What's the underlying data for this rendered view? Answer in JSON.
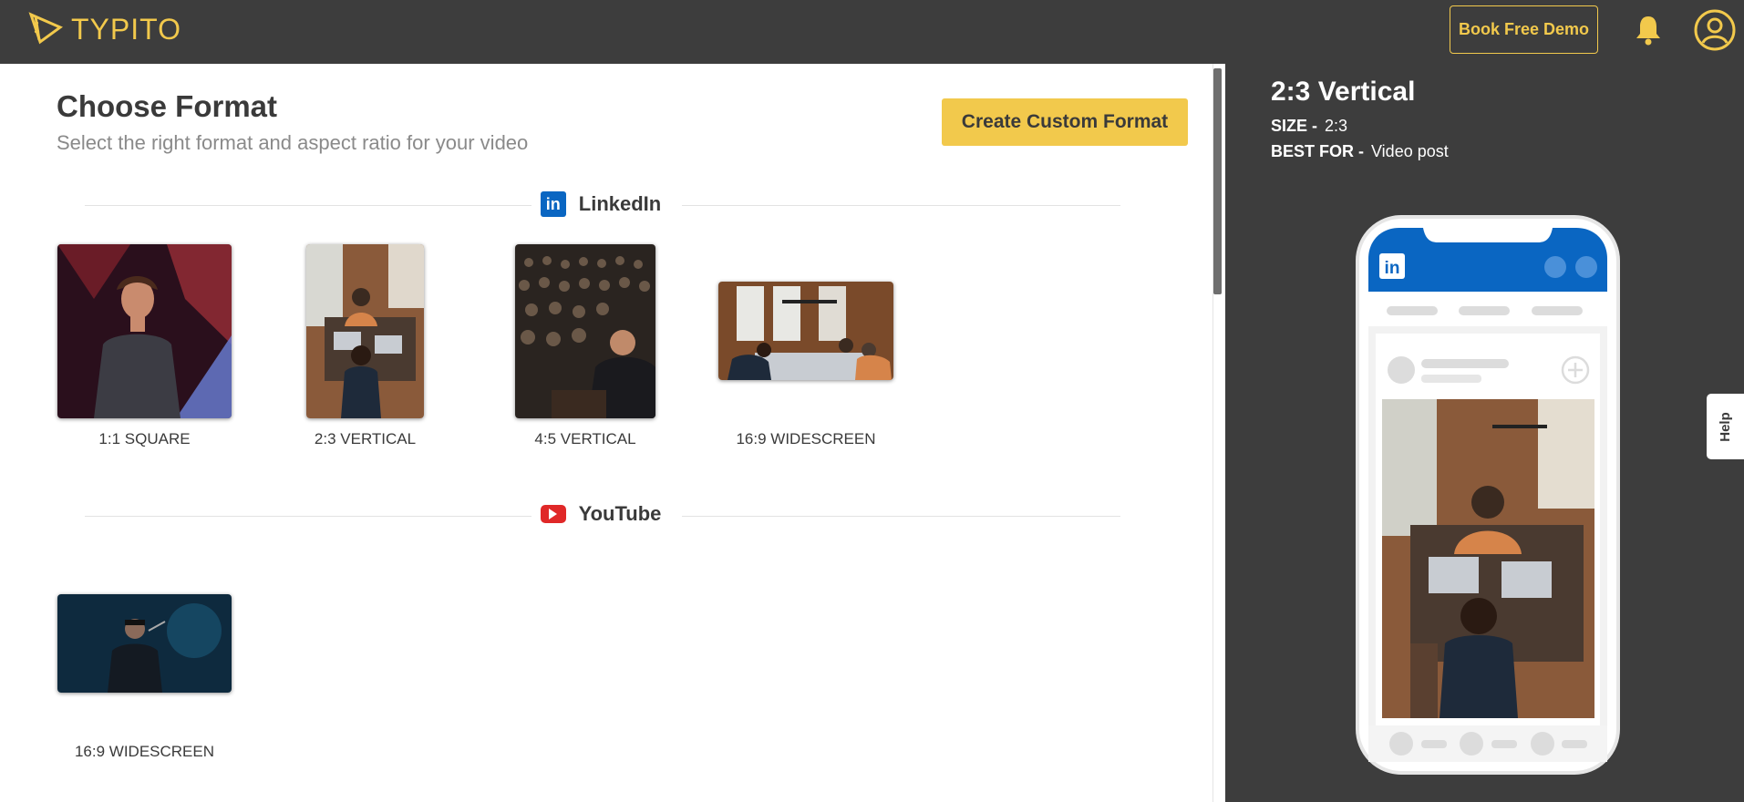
{
  "app": {
    "name": "TYPITO"
  },
  "header": {
    "demo_button": "Book Free Demo",
    "icons": [
      "bell-icon",
      "user-avatar-icon"
    ],
    "accent_color": "#f2c94c",
    "bar_color": "#3d3d3d"
  },
  "main": {
    "title": "Choose Format",
    "subtitle": "Select the right format and aspect ratio for your video",
    "custom_button": "Create Custom Format",
    "sections": [
      {
        "platform": "LinkedIn",
        "icon": "linkedin-icon",
        "formats": [
          {
            "label": "1:1 SQUARE"
          },
          {
            "label": "2:3 VERTICAL"
          },
          {
            "label": "4:5 VERTICAL"
          },
          {
            "label": "16:9 WIDESCREEN"
          }
        ]
      },
      {
        "platform": "YouTube",
        "icon": "youtube-icon",
        "formats": [
          {
            "label": "16:9 WIDESCREEN"
          }
        ]
      }
    ]
  },
  "preview": {
    "title": "2:3 Vertical",
    "size_label": "SIZE -",
    "size_value": "2:3",
    "best_for_label": "BEST FOR -",
    "best_for_value": "Video post",
    "help_tab": "Help",
    "phone_brand": "in"
  }
}
